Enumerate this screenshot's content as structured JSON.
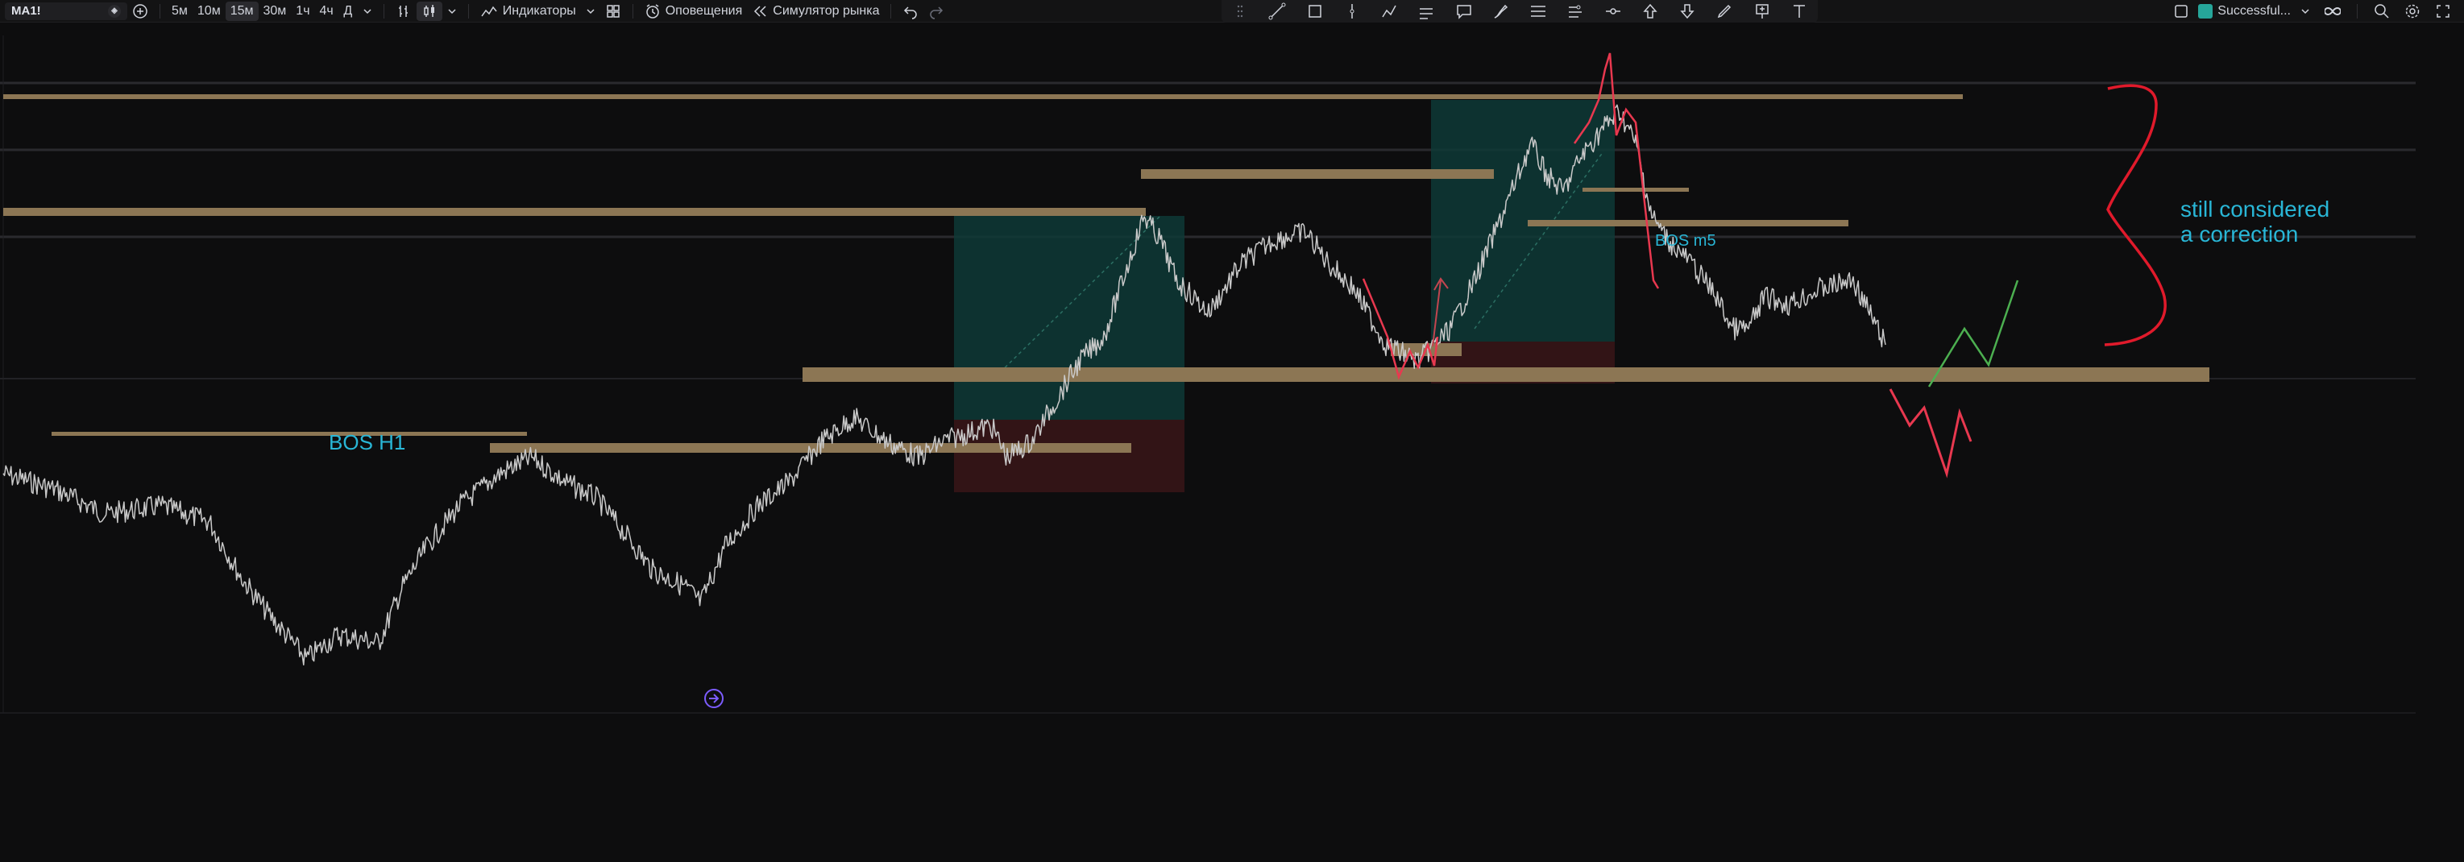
{
  "toolbar": {
    "symbol": "MA1!",
    "timeframes": [
      "5м",
      "10м",
      "15м",
      "30м",
      "1ч",
      "4ч",
      "Д"
    ],
    "active_timeframe": "15м",
    "indicators_label": "Индикаторы",
    "alerts_label": "Оповещения",
    "replay_label": "Симулятор рынка",
    "layout_name": "Successful...",
    "icons": [
      "compare-plus-icon",
      "chevron-down-icon",
      "bar-style-icon",
      "candles-icon",
      "indicators-icon",
      "templates-icon",
      "alert-clock-icon",
      "replay-icon",
      "undo-icon",
      "redo-icon"
    ]
  },
  "drawing_tools": [
    "drag-handle-icon",
    "trendline-icon",
    "rectangle-icon",
    "vertical-line-icon",
    "path-icon",
    "parallel-icon",
    "callout-icon",
    "brush-icon",
    "fib-icon",
    "pitchfork-icon",
    "measure-icon",
    "arrow-up-icon",
    "arrow-down-icon",
    "pen-icon",
    "pin-icon",
    "text-icon"
  ],
  "annotations": {
    "bos_h1": "BOS H1",
    "bos_m5": "BOS m5",
    "correction_line1": "still considered",
    "correction_line2": "a correction"
  },
  "colors": {
    "background": "#0d0d0e",
    "level": "#8c7654",
    "price_line": "#c9c9c9",
    "annotation_text": "#29b6d6",
    "projection_down": "#e8384f",
    "projection_up": "#4caf50",
    "long_zone": "#0e3a36",
    "short_zone": "#3a1618"
  }
}
